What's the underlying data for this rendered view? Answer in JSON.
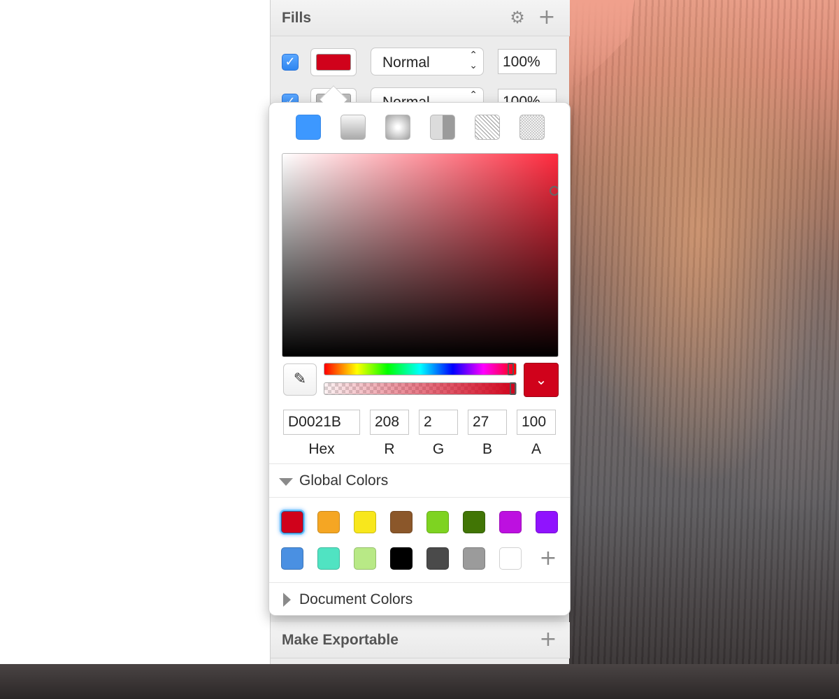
{
  "inspector": {
    "fills": {
      "title": "Fills",
      "rows": [
        {
          "enabled": true,
          "check_glyph": "✓",
          "color": "#D0021B",
          "blend_mode": "Normal",
          "opacity": "100%"
        },
        {
          "enabled": true,
          "check_glyph": "✓",
          "color": "#BBBBBB",
          "blend_mode": "Normal",
          "opacity": "100%"
        }
      ]
    },
    "make_exportable": {
      "title": "Make Exportable"
    }
  },
  "color_picker": {
    "fill_types": [
      "solid",
      "linear-gradient",
      "radial-gradient",
      "angular-gradient",
      "pattern",
      "noise"
    ],
    "selected_fill_type": "solid",
    "current_color": "#D0021B",
    "hue_level": 0.99,
    "alpha_level": 1.0,
    "values": {
      "hex": "D0021B",
      "r": "208",
      "g": "2",
      "b": "27",
      "a": "100"
    },
    "labels": {
      "hex": "Hex",
      "r": "R",
      "g": "G",
      "b": "B",
      "a": "A"
    },
    "global_colors": {
      "title": "Global Colors",
      "expanded": true,
      "swatches": [
        "#D0021B",
        "#F5A623",
        "#F8E71C",
        "#8B572A",
        "#7ED321",
        "#417505",
        "#BD10E0",
        "#9013FE",
        "#4A90E2",
        "#50E3C2",
        "#B8E986",
        "#000000",
        "#4A4A4A",
        "#9B9B9B",
        "#FFFFFF"
      ],
      "selected_index": 0
    },
    "document_colors": {
      "title": "Document Colors",
      "expanded": false
    }
  },
  "icons": {
    "gear": "⚙",
    "plus": "+",
    "eyedropper": "✎",
    "chevron_down": "⌄",
    "stepper": "⌃⌄"
  }
}
